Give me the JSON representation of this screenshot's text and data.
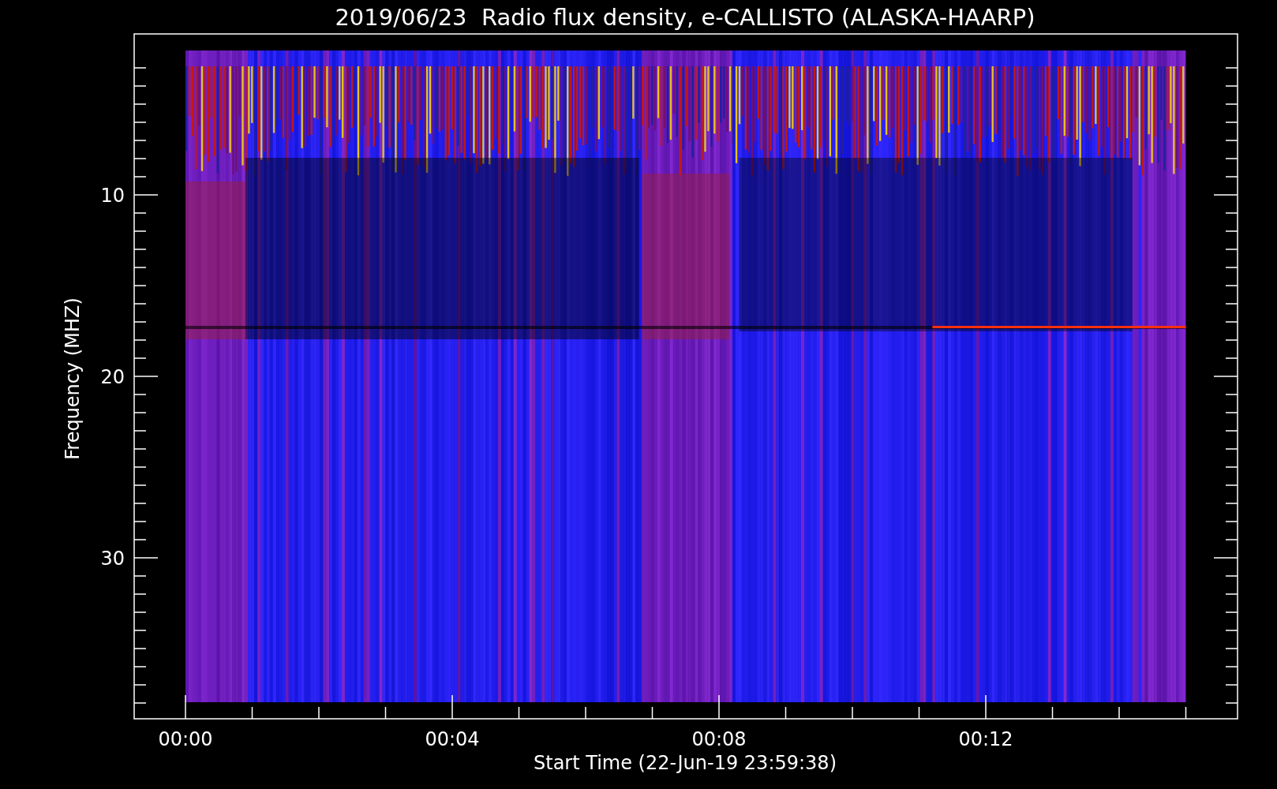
{
  "title": "2019/06/23  Radio flux density, e-CALLISTO (ALASKA-HAARP)",
  "y_axis": {
    "label": "Frequency (MHZ)",
    "ticks": [
      "10",
      "20",
      "30"
    ]
  },
  "x_axis": {
    "label": "Start Time (22-Jun-19 23:59:38)",
    "ticks": [
      "00:00",
      "00:04",
      "00:08",
      "00:12"
    ]
  }
}
